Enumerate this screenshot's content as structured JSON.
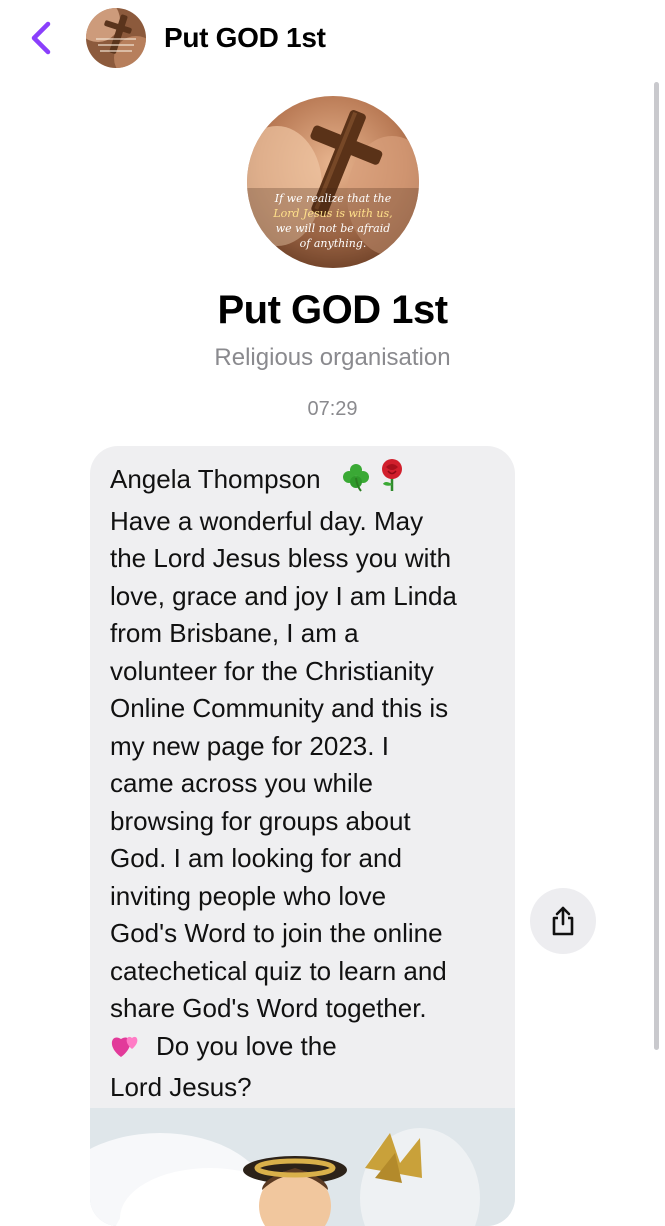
{
  "header": {
    "title": "Put GOD 1st",
    "avatar_icon": "cross-in-hands-avatar",
    "back_icon": "chevron-left-icon",
    "accent_color": "#8a3ffc"
  },
  "profile": {
    "name": "Put GOD 1st",
    "category": "Religious organisation",
    "avatar_quote": [
      "If we realize that the",
      "Lord Jesus is with us,",
      "we will not be afraid",
      "of anything."
    ]
  },
  "conversation": {
    "timestamp": "07:29",
    "message": {
      "lines": [
        "Angela Thompson",
        "Have a wonderful day. May",
        "the Lord Jesus bless you with",
        "love, grace and joy I am Linda",
        "from Brisbane, I am a",
        "volunteer for the Christianity",
        "Online Community and this is",
        "my new page for 2023. I",
        "came across you while",
        "browsing for groups about",
        "God. I am looking for and",
        "inviting people who love",
        "God's Word to join the online",
        "catechetical quiz to learn and",
        "share God's Word together.",
        "Do you love  the",
        "Lord Jesus?"
      ],
      "emojis": [
        "shamrock",
        "rose",
        "two-hearts"
      ],
      "attachment": "angel-figurine-image"
    },
    "share_icon": "share-icon"
  }
}
